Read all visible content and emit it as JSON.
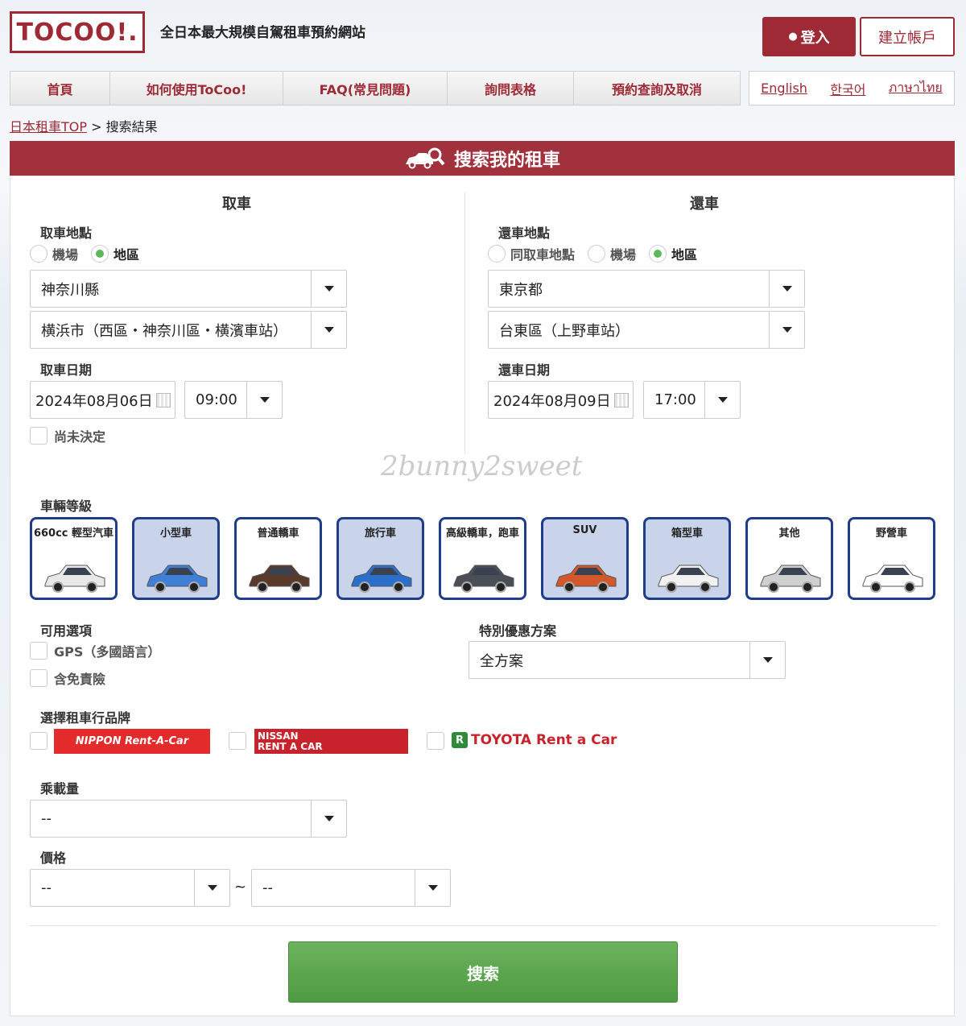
{
  "header": {
    "logo_text": "TOCOO!.",
    "tagline": "全日本最大規模自駕租車預約網站",
    "login_label": "登入",
    "register_label": "建立帳戶"
  },
  "nav": {
    "items": [
      "首頁",
      "如何使用ToCoo!",
      "FAQ(常見問題)",
      "詢問表格",
      "預約查詢及取消"
    ],
    "languages": [
      "English",
      "한국어",
      "ภาษาไทย"
    ]
  },
  "breadcrumb": {
    "home": "日本租車TOP",
    "separator": ">",
    "current": "搜索結果"
  },
  "search": {
    "title": "搜索我的租車",
    "pickup": {
      "section_title": "取車",
      "location_label": "取車地點",
      "location_options": [
        "機場",
        "地區"
      ],
      "selected_option": "地區",
      "prefecture": "神奈川縣",
      "area": "横浜市（西區・神奈川區・横濱車站）",
      "date_label": "取車日期",
      "date": "2024年08月06日",
      "time": "09:00",
      "undecided_label": "尚未決定"
    },
    "return": {
      "section_title": "還車",
      "location_label": "還車地點",
      "location_options": [
        "同取車地點",
        "機場",
        "地區"
      ],
      "selected_option": "地區",
      "prefecture": "東京都",
      "area": "台東區（上野車站）",
      "date_label": "還車日期",
      "date": "2024年08月09日",
      "time": "17:00"
    },
    "watermark": "2bunny2sweet",
    "car_class_label": "車輛等級",
    "car_classes": [
      {
        "name": "660cc 輕型汽車",
        "selected": false,
        "color": "#e8e8e8"
      },
      {
        "name": "小型車",
        "selected": true,
        "color": "#3f7fd6"
      },
      {
        "name": "普通轎車",
        "selected": false,
        "color": "#5a3a2a"
      },
      {
        "name": "旅行車",
        "selected": true,
        "color": "#2a6fc9"
      },
      {
        "name": "高級轎車，跑車",
        "selected": false,
        "color": "#4a4f57"
      },
      {
        "name": "SUV",
        "selected": true,
        "color": "#d2582b"
      },
      {
        "name": "箱型車",
        "selected": true,
        "color": "#f1f1f1"
      },
      {
        "name": "其他",
        "selected": false,
        "color": "#cfcfcf"
      },
      {
        "name": "野營車",
        "selected": false,
        "color": "#ffffff"
      }
    ],
    "options_label": "可用選項",
    "options": [
      "GPS（多國語言）",
      "含免責險"
    ],
    "special_label": "特別優惠方案",
    "special_value": "全方案",
    "brand_label": "選擇租車行品牌",
    "brands": {
      "nippon": "NIPPON Rent-A-Car",
      "nissan_line1": "NISSAN",
      "nissan_line2": "RENT A CAR",
      "toyota": "TOYOTA Rent a Car"
    },
    "capacity_label": "乘載量",
    "capacity_value": "--",
    "price_label": "價格",
    "price_min": "--",
    "price_separator": "~",
    "price_max": "--",
    "submit_label": "搜索"
  },
  "colors": {
    "brand": "#9e2a36",
    "header_bar": "#a0313d",
    "search_button": "#5ba84e",
    "card_border": "#1f3d8a"
  }
}
